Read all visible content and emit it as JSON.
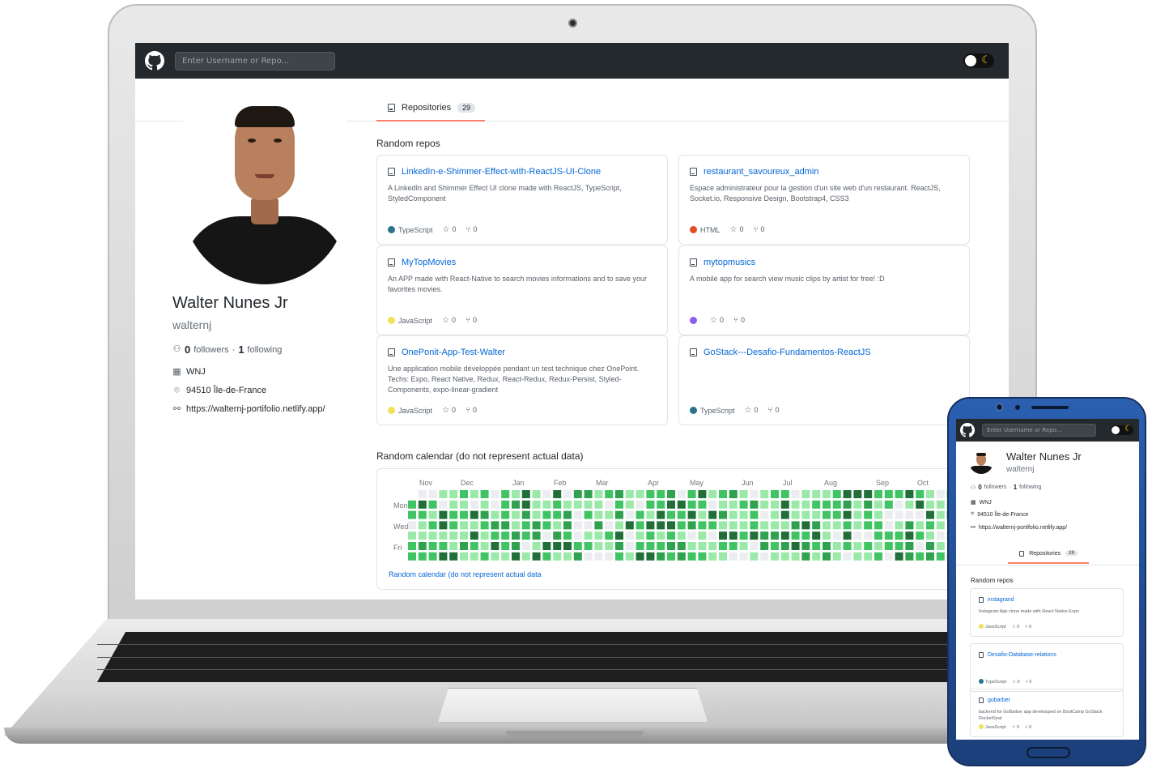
{
  "header": {
    "search_placeholder": "Enter Username or Repo...",
    "theme_toggle_icon": "moon-icon"
  },
  "profile": {
    "name": "Walter Nunes Jr",
    "login": "walternj",
    "followers_count": "0",
    "followers_label": "followers",
    "separator": "·",
    "following_count": "1",
    "following_label": "following",
    "company": "WNJ",
    "location": "94510 Île-de-France",
    "website": "https://walternj-portifolio.netlify.app/"
  },
  "tabs": [
    {
      "label": "Repositories",
      "count": "29"
    }
  ],
  "random_repos": {
    "title": "Random repos",
    "items": [
      {
        "name": "LinkedIn-e-Shimmer-Effect-with-ReactJS-UI-Clone",
        "description": "A LinkedIn and Shimmer Effect UI clone made with ReactJS, TypeScript, StyledComponent",
        "language": "TypeScript",
        "language_color": "#2b7489",
        "stars": "0",
        "forks": "0"
      },
      {
        "name": "restaurant_savoureux_admin",
        "description": "Espace administrateur pour la gestion d'un site web d'un restaurant. ReactJS, Socket.io, Responsive Design, Bootstrap4, CSS3",
        "language": "HTML",
        "language_color": "#e34c26",
        "stars": "0",
        "forks": "0"
      },
      {
        "name": "MyTopMovies",
        "description": "An APP made with React-Native to search movies informations and to save your favorites movies.",
        "language": "JavaScript",
        "language_color": "#f1e05a",
        "stars": "0",
        "forks": "0"
      },
      {
        "name": "mytopmusics",
        "description": "A mobile app for search view music clips by artist for free! :D",
        "language": "",
        "language_color": "#8e5ef0",
        "stars": "0",
        "forks": "0"
      },
      {
        "name": "OnePonit-App-Test-Walter",
        "description": "Une application mobile développée pendant un test technique chez OnePoint. Techs: Expo, React Native, Redux, React-Redux, Redux-Persist, Styled-Components, expo-linear-gradient",
        "language": "JavaScript",
        "language_color": "#f1e05a",
        "stars": "0",
        "forks": "0"
      },
      {
        "name": "GoStack---Desafio-Fundamentos-ReactJS",
        "description": "",
        "language": "TypeScript",
        "language_color": "#2b7489",
        "stars": "0",
        "forks": "0"
      }
    ]
  },
  "calendar": {
    "title": "Random calendar (do not represent actual data)",
    "months": [
      "Nov",
      "Dec",
      "Jan",
      "Feb",
      "Mar",
      "Apr",
      "May",
      "Jun",
      "Jul",
      "Aug",
      "Sep",
      "Oct"
    ],
    "day_labels": [
      "Mon",
      "Wed",
      "Fri"
    ],
    "link_text": "Random calendar (do not represent actual data",
    "colors": [
      "#ebedf0",
      "#9be9a8",
      "#40c463",
      "#30a14e",
      "#216e39"
    ]
  },
  "mobile": {
    "search_placeholder": "Enter Username or Repo...",
    "name": "Walter Nunes Jr",
    "login": "walternj",
    "followers_count": "0",
    "followers_label": "followers",
    "separator": "·",
    "following_count": "1",
    "following_label": "following",
    "company": "WNJ",
    "location": "94510 Île-de-France",
    "website": "https://walternj-portifolio.netlify.app/",
    "tab_label": "Repositories",
    "tab_count": "29",
    "section_title": "Random repos",
    "repos": [
      {
        "name": "instagrand",
        "description": "Instagram App clone made with React Native Expo",
        "language": "JavaScript",
        "language_color": "#f1e05a",
        "stars": "0",
        "forks": "0"
      },
      {
        "name": "Desafio-Database-relations",
        "description": "",
        "language": "TypeScript",
        "language_color": "#2b7489",
        "stars": "0",
        "forks": "0"
      },
      {
        "name": "gobarber",
        "description": "backend for GoBarber app developped on BootCamp GoStack RocketSeat",
        "language": "JavaScript",
        "language_color": "#f1e05a",
        "stars": "0",
        "forks": "0"
      }
    ]
  }
}
